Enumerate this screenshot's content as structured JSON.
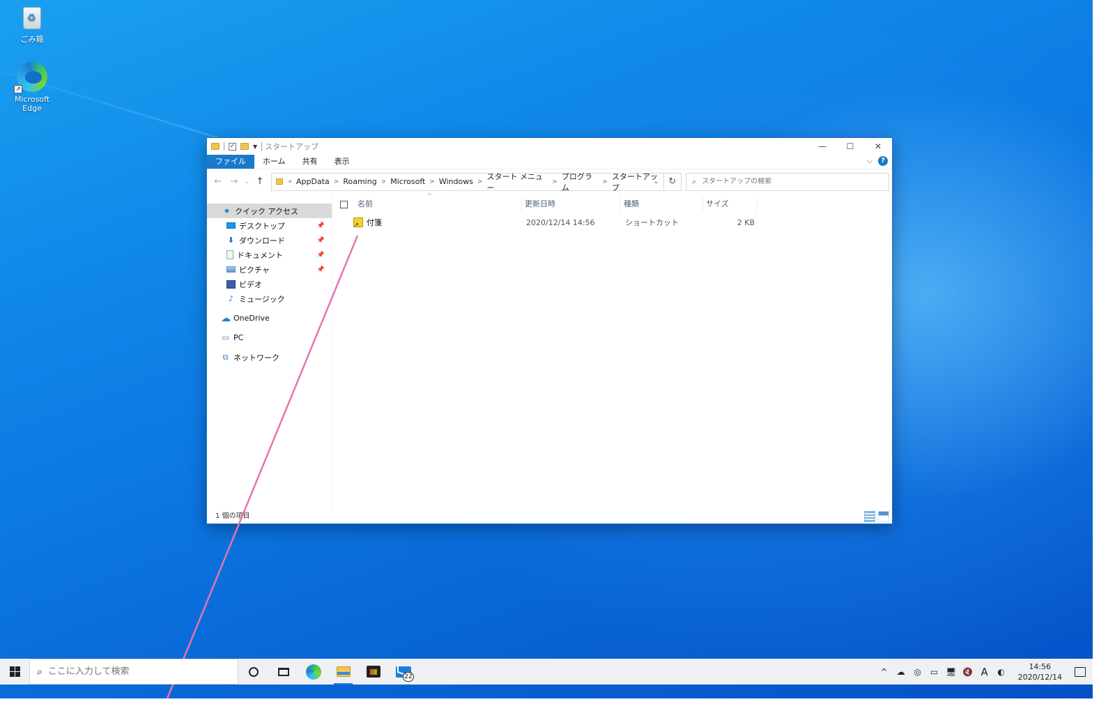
{
  "desktop": {
    "icons": [
      {
        "label": "ごみ箱",
        "icon": "recycle-bin-icon"
      },
      {
        "label": "Microsoft Edge",
        "icon": "edge-icon"
      }
    ]
  },
  "window": {
    "title": "スタートアップ",
    "controls": {
      "minimize": "—",
      "maximize": "☐",
      "close": "✕"
    },
    "ribbon_tabs": [
      "ファイル",
      "ホーム",
      "共有",
      "表示"
    ],
    "address": {
      "more": "«",
      "crumbs": [
        "AppData",
        "Roaming",
        "Microsoft",
        "Windows",
        "スタート メニュー",
        "プログラム",
        "スタートアップ"
      ]
    },
    "search_placeholder": "スタートアップの検索",
    "nav": {
      "quick_access": "クイック アクセス",
      "items": [
        {
          "label": "デスクトップ",
          "icon": "desktop-folder-icon",
          "pinned": true
        },
        {
          "label": "ダウンロード",
          "icon": "download-folder-icon",
          "pinned": true
        },
        {
          "label": "ドキュメント",
          "icon": "documents-folder-icon",
          "pinned": true
        },
        {
          "label": "ピクチャ",
          "icon": "pictures-folder-icon",
          "pinned": true
        },
        {
          "label": "ビデオ",
          "icon": "videos-folder-icon",
          "pinned": false
        },
        {
          "label": "ミュージック",
          "icon": "music-folder-icon",
          "pinned": false
        }
      ],
      "onedrive": "OneDrive",
      "pc": "PC",
      "network": "ネットワーク"
    },
    "columns": [
      "名前",
      "更新日時",
      "種類",
      "サイズ"
    ],
    "files": [
      {
        "name": "付箋",
        "modified": "2020/12/14 14:56",
        "type": "ショートカット",
        "size": "2 KB",
        "icon": "sticky-notes-shortcut-icon"
      }
    ],
    "status": "1 個の項目"
  },
  "taskbar": {
    "search_placeholder": "ここに入力して検索",
    "mail_badge": "22",
    "ime": "A",
    "time": "14:56",
    "date": "2020/12/14"
  }
}
